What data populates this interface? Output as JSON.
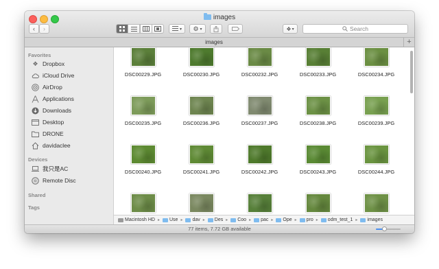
{
  "window": {
    "title": "images",
    "folder_icon": "folder-icon"
  },
  "toolbar": {
    "back_icon": "‹",
    "forward_icon": "›",
    "search_placeholder": "Search",
    "view_buttons": [
      "icon-view",
      "list-view",
      "column-view",
      "coverflow-view"
    ]
  },
  "tabbar": {
    "tab_label": "images",
    "add_label": "+"
  },
  "sidebar": {
    "favorites_heading": "Favorites",
    "favorites": [
      {
        "label": "Dropbox",
        "icon": "dropbox-icon"
      },
      {
        "label": "iCloud Drive",
        "icon": "cloud-icon"
      },
      {
        "label": "AirDrop",
        "icon": "airdrop-icon"
      },
      {
        "label": "Applications",
        "icon": "applications-icon"
      },
      {
        "label": "Downloads",
        "icon": "downloads-icon"
      },
      {
        "label": "Desktop",
        "icon": "desktop-icon"
      },
      {
        "label": "DRONE",
        "icon": "folder-icon"
      },
      {
        "label": "davidaclee",
        "icon": "home-icon"
      }
    ],
    "devices_heading": "Devices",
    "devices": [
      {
        "label": "我只是AC",
        "icon": "laptop-icon"
      },
      {
        "label": "Remote Disc",
        "icon": "disc-icon"
      }
    ],
    "shared_heading": "Shared",
    "tags_heading": "Tags"
  },
  "files": [
    {
      "name": "DSC00229.JPG",
      "color": "#5b7f3a"
    },
    {
      "name": "DSC00230.JPG",
      "color": "#4e7a2e"
    },
    {
      "name": "DSC00232.JPG",
      "color": "#6a8a45"
    },
    {
      "name": "DSC00233.JPG",
      "color": "#587f35"
    },
    {
      "name": "DSC00234.JPG",
      "color": "#6b8f42"
    },
    {
      "name": "DSC00235.JPG",
      "color": "#7d9b5a"
    },
    {
      "name": "DSC00236.JPG",
      "color": "#6e8550"
    },
    {
      "name": "DSC00237.JPG",
      "color": "#808a70"
    },
    {
      "name": "DSC00238.JPG",
      "color": "#6c9145"
    },
    {
      "name": "DSC00239.JPG",
      "color": "#78a050"
    },
    {
      "name": "DSC00240.JPG",
      "color": "#5d8a32"
    },
    {
      "name": "DSC00241.JPG",
      "color": "#5f8a35"
    },
    {
      "name": "DSC00242.JPG",
      "color": "#4f7a2c"
    },
    {
      "name": "DSC00243.JPG",
      "color": "#5a8a34"
    },
    {
      "name": "DSC00244.JPG",
      "color": "#6a9440"
    },
    {
      "name": "",
      "color": "#6d8c48"
    },
    {
      "name": "",
      "color": "#7a8860"
    },
    {
      "name": "",
      "color": "#57803a"
    },
    {
      "name": "",
      "color": "#65883e"
    },
    {
      "name": "",
      "color": "#6e9146"
    }
  ],
  "pathbar": {
    "crumbs": [
      "Macintosh HD",
      "Use",
      "dav",
      "Des",
      "Coo",
      "pac",
      "Ope",
      "pro",
      "odm_test_1",
      "images"
    ]
  },
  "statusbar": {
    "text": "77 items, 7.72 GB available",
    "zoom_level": 0.35
  }
}
